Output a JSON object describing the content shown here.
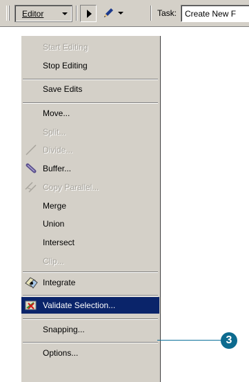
{
  "toolbar": {
    "editor_menu_label": "Editor",
    "task_label": "Task:",
    "task_value": "Create New F"
  },
  "menu": {
    "items": [
      {
        "label": "Start Editing",
        "disabled": true
      },
      {
        "label": "Stop Editing",
        "disabled": false
      },
      {
        "label": "Save Edits",
        "disabled": false
      },
      {
        "label": "Move...",
        "disabled": false
      },
      {
        "label": "Split...",
        "disabled": true
      },
      {
        "label": "Divide...",
        "disabled": true,
        "icon": "divide-icon"
      },
      {
        "label": "Buffer...",
        "disabled": false,
        "icon": "buffer-icon"
      },
      {
        "label": "Copy Parallel...",
        "disabled": true,
        "icon": "copy-parallel-icon"
      },
      {
        "label": "Merge",
        "disabled": false
      },
      {
        "label": "Union",
        "disabled": false
      },
      {
        "label": "Intersect",
        "disabled": false
      },
      {
        "label": "Clip...",
        "disabled": true
      },
      {
        "label": "Integrate",
        "disabled": false,
        "icon": "integrate-icon"
      },
      {
        "label": "Validate Selection...",
        "disabled": false,
        "highlighted": true,
        "icon": "validate-selection-icon"
      },
      {
        "label": "Snapping...",
        "disabled": false
      },
      {
        "label": "Options...",
        "disabled": false
      }
    ]
  },
  "callout": {
    "number": "3"
  },
  "colors": {
    "menu_background": "#d4d0c8",
    "highlight": "#0a246a",
    "callout": "#0d6b8f"
  }
}
